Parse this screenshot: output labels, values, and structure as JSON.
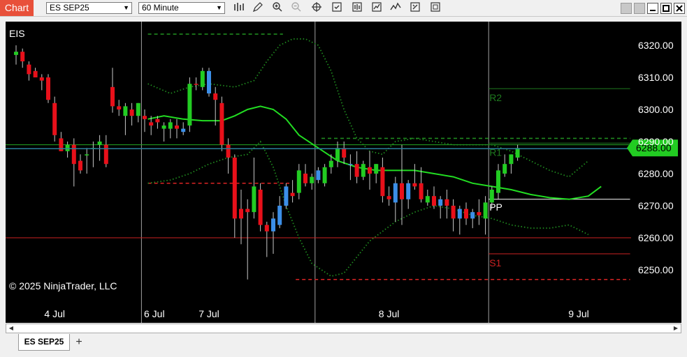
{
  "toolbar": {
    "chart_label": "Chart",
    "instrument": "ES SEP25",
    "interval": "60 Minute",
    "icons": [
      "bars-type-icon",
      "draw-pencil-icon",
      "zoom-in-icon",
      "zoom-out-icon",
      "crosshair-icon",
      "properties-icon",
      "data-box-icon",
      "indicators-icon",
      "strategies-icon",
      "templates-icon",
      "trade-icon"
    ],
    "window_buttons": [
      "restore-icon",
      "minimize-icon",
      "maximize-icon",
      "close-icon"
    ]
  },
  "tabs": {
    "active": "ES SEP25",
    "add": "+"
  },
  "chart_data": {
    "type": "candlestick",
    "symbol_label": "EIS",
    "copyright": "© 2025 NinjaTrader, LLC",
    "ylim": [
      6242,
      6330
    ],
    "y_ticks": [
      6320,
      6310,
      6300,
      6290,
      6280,
      6270,
      6260,
      6250
    ],
    "y_tick_labels": [
      "6320.00",
      "6310.00",
      "6300.00",
      "6290.00",
      "6280.00",
      "6270.00",
      "6260.00",
      "6250.00"
    ],
    "x_labels": [
      {
        "label": "4 Jul",
        "bar": 6
      },
      {
        "label": "6 Jul",
        "bar": 21.5
      },
      {
        "label": "7 Jul",
        "bar": 30
      },
      {
        "label": "8 Jul",
        "bar": 58
      },
      {
        "label": "9 Jul",
        "bar": 87.5
      }
    ],
    "session_breaks": [
      19.5,
      46.5,
      73.5
    ],
    "last_price": 6288.0,
    "last_price_label": "6288.00",
    "reference_lines": [
      {
        "price": 6289.0,
        "color": "#22aa22",
        "style": "solid"
      },
      {
        "price": 6260.0,
        "color": "#cc2222",
        "style": "solid"
      }
    ],
    "pivot_levels": [
      {
        "name": "R2",
        "label": "R2",
        "price": 6306.5,
        "x0": 73.5,
        "x1": 95.5,
        "color": "#1f7a1f",
        "style": "solid"
      },
      {
        "name": "R1",
        "label": "R1",
        "price": 6289.5,
        "x0": 73.5,
        "x1": 95.5,
        "color": "#1f7a1f",
        "style": "solid"
      },
      {
        "name": "PP",
        "label": "PP",
        "price": 6272.0,
        "x0": 73.5,
        "x1": 95.5,
        "color": "#ffffff",
        "style": "solid"
      },
      {
        "name": "S1",
        "label": "S1",
        "price": 6255.0,
        "x0": 73.5,
        "x1": 95.5,
        "color": "#cc2222",
        "style": "solid"
      },
      {
        "name": "prior-R",
        "price": 6323.5,
        "x0": 20.5,
        "x1": 41.5,
        "color": "#1f8a1f",
        "style": "dashed"
      },
      {
        "name": "prior-S",
        "price": 6277.0,
        "x0": 20.5,
        "x1": 42.5,
        "color": "#cc2222",
        "style": "dashed"
      },
      {
        "name": "day-R",
        "price": 6291.0,
        "x0": 47.5,
        "x1": 95.5,
        "color": "#1f8a1f",
        "style": "dashed"
      },
      {
        "name": "day-S",
        "price": 6247.0,
        "x0": 43.5,
        "x1": 95.5,
        "color": "#cc2222",
        "style": "dashed"
      }
    ],
    "colors": {
      "up": "#22cc22",
      "down": "#e8101a",
      "bull_neutral": "#3c8fe8",
      "ma": "#22dd22",
      "bands": "#1f8a1f",
      "wick": "#c8c8c8"
    },
    "series": [
      {
        "name": "OHLC",
        "bars": [
          {
            "o": 6317,
            "h": 6320,
            "l": 6314,
            "c": 6318,
            "col": "up"
          },
          {
            "o": 6318,
            "h": 6319,
            "l": 6313,
            "c": 6315,
            "col": "down"
          },
          {
            "o": 6314,
            "h": 6315,
            "l": 6309,
            "c": 6311,
            "col": "down"
          },
          {
            "o": 6312,
            "h": 6313,
            "l": 6310,
            "c": 6310,
            "col": "down"
          },
          {
            "o": 6309,
            "h": 6311,
            "l": 6306,
            "c": 6310,
            "col": "down"
          },
          {
            "o": 6310,
            "h": 6311,
            "l": 6302,
            "c": 6303,
            "col": "down"
          },
          {
            "o": 6302,
            "h": 6304,
            "l": 6290,
            "c": 6292,
            "col": "down"
          },
          {
            "o": 6291,
            "h": 6293,
            "l": 6287,
            "c": 6287,
            "col": "down"
          },
          {
            "o": 6287,
            "h": 6290,
            "l": 6285,
            "c": 6289,
            "col": "up"
          },
          {
            "o": 6289,
            "h": 6291,
            "l": 6276,
            "c": 6283,
            "col": "down"
          },
          {
            "o": 6284,
            "h": 6286,
            "l": 6280,
            "c": 6281,
            "col": "down"
          },
          {
            "o": 6286,
            "h": 6288,
            "l": 6280,
            "c": 6286,
            "col": "up"
          },
          {
            "o": 6288,
            "h": 6290,
            "l": 6282,
            "c": 6288,
            "col": "up"
          },
          {
            "o": 6290,
            "h": 6292,
            "l": 6284,
            "c": 6289,
            "col": "up"
          },
          {
            "o": 6289,
            "h": 6292,
            "l": 6282,
            "c": 6283,
            "col": "down"
          },
          {
            "o": 6307,
            "h": 6313,
            "l": 6299,
            "c": 6301,
            "col": "down"
          },
          {
            "o": 6301,
            "h": 6303,
            "l": 6298,
            "c": 6300,
            "col": "down"
          },
          {
            "o": 6298,
            "h": 6302,
            "l": 6292,
            "c": 6301,
            "col": "up"
          },
          {
            "o": 6300,
            "h": 6302,
            "l": 6295,
            "c": 6298,
            "col": "down"
          },
          {
            "o": 6298,
            "h": 6302,
            "l": 6296,
            "c": 6302,
            "col": "up"
          },
          {
            "o": 6298,
            "h": 6300,
            "l": 6293,
            "c": 6297,
            "col": "down"
          },
          {
            "o": 6296,
            "h": 6298,
            "l": 6292,
            "c": 6295,
            "col": "down"
          },
          {
            "o": 6297,
            "h": 6298,
            "l": 6294,
            "c": 6296,
            "col": "down"
          },
          {
            "o": 6294,
            "h": 6296,
            "l": 6290,
            "c": 6295,
            "col": "up"
          },
          {
            "o": 6294,
            "h": 6297,
            "l": 6291,
            "c": 6296,
            "col": "up"
          },
          {
            "o": 6295,
            "h": 6297,
            "l": 6291,
            "c": 6294,
            "col": "down"
          },
          {
            "o": 6293,
            "h": 6296,
            "l": 6292,
            "c": 6294,
            "col": "bull_neutral"
          },
          {
            "o": 6295,
            "h": 6310,
            "l": 6293,
            "c": 6308,
            "col": "up"
          },
          {
            "o": 6308,
            "h": 6310,
            "l": 6306,
            "c": 6308,
            "col": "down"
          },
          {
            "o": 6307,
            "h": 6313,
            "l": 6306,
            "c": 6312,
            "col": "up"
          },
          {
            "o": 6312,
            "h": 6313,
            "l": 6304,
            "c": 6305,
            "col": "bull_neutral"
          },
          {
            "o": 6305,
            "h": 6307,
            "l": 6295,
            "c": 6303,
            "col": "down"
          },
          {
            "o": 6302,
            "h": 6304,
            "l": 6287,
            "c": 6289,
            "col": "down"
          },
          {
            "o": 6289,
            "h": 6291,
            "l": 6280,
            "c": 6285,
            "col": "down"
          },
          {
            "o": 6285,
            "h": 6286,
            "l": 6260,
            "c": 6266,
            "col": "down"
          },
          {
            "o": 6266,
            "h": 6275,
            "l": 6258,
            "c": 6269,
            "col": "down"
          },
          {
            "o": 6269,
            "h": 6272,
            "l": 6247,
            "c": 6268,
            "col": "down"
          },
          {
            "o": 6268,
            "h": 6285,
            "l": 6266,
            "c": 6276,
            "col": "up"
          },
          {
            "o": 6275,
            "h": 6277,
            "l": 6262,
            "c": 6264,
            "col": "down"
          },
          {
            "o": 6264,
            "h": 6265,
            "l": 6254,
            "c": 6262,
            "col": "down"
          },
          {
            "o": 6262,
            "h": 6268,
            "l": 6255,
            "c": 6266,
            "col": "bull_neutral"
          },
          {
            "o": 6264,
            "h": 6273,
            "l": 6263,
            "c": 6270,
            "col": "bull_neutral"
          },
          {
            "o": 6270,
            "h": 6277,
            "l": 6269,
            "c": 6276,
            "col": "bull_neutral"
          },
          {
            "o": 6273,
            "h": 6278,
            "l": 6271,
            "c": 6274,
            "col": "down"
          },
          {
            "o": 6274,
            "h": 6283,
            "l": 6272,
            "c": 6281,
            "col": "up"
          },
          {
            "o": 6280,
            "h": 6283,
            "l": 6276,
            "c": 6277,
            "col": "down"
          },
          {
            "o": 6277,
            "h": 6280,
            "l": 6275,
            "c": 6279,
            "col": "up"
          },
          {
            "o": 6278,
            "h": 6282,
            "l": 6277,
            "c": 6281,
            "col": "bull_neutral"
          },
          {
            "o": 6277,
            "h": 6283,
            "l": 6276,
            "c": 6282,
            "col": "up"
          },
          {
            "o": 6282,
            "h": 6286,
            "l": 6280,
            "c": 6284,
            "col": "up"
          },
          {
            "o": 6284,
            "h": 6290,
            "l": 6282,
            "c": 6288,
            "col": "up"
          },
          {
            "o": 6288,
            "h": 6290,
            "l": 6283,
            "c": 6285,
            "col": "down"
          },
          {
            "o": 6283,
            "h": 6286,
            "l": 6278,
            "c": 6283,
            "col": "bull_neutral"
          },
          {
            "o": 6283,
            "h": 6287,
            "l": 6277,
            "c": 6279,
            "col": "down"
          },
          {
            "o": 6279,
            "h": 6284,
            "l": 6278,
            "c": 6283,
            "col": "up"
          },
          {
            "o": 6282,
            "h": 6287,
            "l": 6275,
            "c": 6280,
            "col": "down"
          },
          {
            "o": 6280,
            "h": 6283,
            "l": 6277,
            "c": 6283,
            "col": "up"
          },
          {
            "o": 6282,
            "h": 6285,
            "l": 6271,
            "c": 6273,
            "col": "down"
          },
          {
            "o": 6273,
            "h": 6276,
            "l": 6270,
            "c": 6272,
            "col": "down"
          },
          {
            "o": 6271,
            "h": 6279,
            "l": 6265,
            "c": 6277,
            "col": "bull_neutral"
          },
          {
            "o": 6277,
            "h": 6289,
            "l": 6264,
            "c": 6272,
            "col": "down"
          },
          {
            "o": 6272,
            "h": 6278,
            "l": 6269,
            "c": 6277,
            "col": "bull_neutral"
          },
          {
            "o": 6277,
            "h": 6283,
            "l": 6275,
            "c": 6276,
            "col": "down"
          },
          {
            "o": 6277,
            "h": 6282,
            "l": 6271,
            "c": 6272,
            "col": "down"
          },
          {
            "o": 6271,
            "h": 6275,
            "l": 6270,
            "c": 6273,
            "col": "up"
          },
          {
            "o": 6273,
            "h": 6276,
            "l": 6269,
            "c": 6270,
            "col": "down"
          },
          {
            "o": 6270,
            "h": 6273,
            "l": 6266,
            "c": 6272,
            "col": "bull_neutral"
          },
          {
            "o": 6272,
            "h": 6275,
            "l": 6266,
            "c": 6270,
            "col": "down"
          },
          {
            "o": 6270,
            "h": 6272,
            "l": 6262,
            "c": 6266,
            "col": "down"
          },
          {
            "o": 6266,
            "h": 6270,
            "l": 6261,
            "c": 6269,
            "col": "bull_neutral"
          },
          {
            "o": 6269,
            "h": 6271,
            "l": 6264,
            "c": 6266,
            "col": "down"
          },
          {
            "o": 6266,
            "h": 6269,
            "l": 6263,
            "c": 6268,
            "col": "bull_neutral"
          },
          {
            "o": 6268,
            "h": 6272,
            "l": 6264,
            "c": 6267,
            "col": "down"
          },
          {
            "o": 6266,
            "h": 6273,
            "l": 6261,
            "c": 6271,
            "col": "up"
          },
          {
            "o": 6271,
            "h": 6276,
            "l": 6269,
            "c": 6275,
            "col": "up"
          },
          {
            "o": 6274,
            "h": 6283,
            "l": 6272,
            "c": 6281,
            "col": "up"
          },
          {
            "o": 6280,
            "h": 6286,
            "l": 6279,
            "c": 6283,
            "col": "up"
          },
          {
            "o": 6283,
            "h": 6286,
            "l": 6280,
            "c": 6286,
            "col": "up"
          },
          {
            "o": 6285,
            "h": 6289,
            "l": 6284,
            "c": 6288,
            "col": "up"
          }
        ]
      },
      {
        "name": "MA",
        "points": [
          [
            20.5,
            6297
          ],
          [
            23,
            6298
          ],
          [
            26,
            6297
          ],
          [
            29,
            6296.5
          ],
          [
            32,
            6296.5
          ],
          [
            34,
            6298
          ],
          [
            36,
            6300
          ],
          [
            38,
            6301
          ],
          [
            40,
            6300
          ],
          [
            42,
            6297
          ],
          [
            44,
            6292
          ],
          [
            47,
            6288
          ],
          [
            50,
            6284
          ],
          [
            53,
            6282
          ],
          [
            56,
            6281
          ],
          [
            59,
            6281
          ],
          [
            62,
            6281
          ],
          [
            65,
            6280
          ],
          [
            68,
            6279
          ],
          [
            71,
            6277
          ],
          [
            74,
            6276
          ],
          [
            77,
            6275
          ],
          [
            80,
            6273.5
          ],
          [
            83,
            6272.5
          ],
          [
            86,
            6272
          ],
          [
            89,
            6273
          ],
          [
            91,
            6276
          ]
        ]
      },
      {
        "name": "BandUpper",
        "points": [
          [
            20.5,
            6308
          ],
          [
            24,
            6305
          ],
          [
            27,
            6307
          ],
          [
            30,
            6308
          ],
          [
            34,
            6307
          ],
          [
            37,
            6309
          ],
          [
            39,
            6315
          ],
          [
            41,
            6320
          ],
          [
            43,
            6322
          ],
          [
            45,
            6322
          ],
          [
            47,
            6320
          ],
          [
            49,
            6312
          ],
          [
            51,
            6300
          ],
          [
            53,
            6291
          ],
          [
            55,
            6287
          ],
          [
            57,
            6286
          ],
          [
            59,
            6290
          ],
          [
            62,
            6291
          ],
          [
            65,
            6290
          ],
          [
            68,
            6289
          ],
          [
            71,
            6289
          ],
          [
            74,
            6289
          ],
          [
            77,
            6287
          ],
          [
            80,
            6284
          ],
          [
            83,
            6281
          ],
          [
            86,
            6279
          ],
          [
            89,
            6284
          ]
        ]
      },
      {
        "name": "BandLower",
        "points": [
          [
            20.5,
            6277
          ],
          [
            24,
            6278
          ],
          [
            27,
            6280
          ],
          [
            30,
            6283
          ],
          [
            33,
            6285
          ],
          [
            36,
            6286
          ],
          [
            38,
            6290
          ],
          [
            40,
            6282
          ],
          [
            42,
            6270
          ],
          [
            44,
            6260
          ],
          [
            46,
            6252
          ],
          [
            49,
            6248
          ],
          [
            51,
            6249
          ],
          [
            53,
            6254
          ],
          [
            55,
            6259
          ],
          [
            57,
            6262
          ],
          [
            59,
            6265
          ],
          [
            62,
            6268
          ],
          [
            65,
            6270
          ],
          [
            68,
            6269
          ],
          [
            71,
            6267
          ],
          [
            74,
            6266
          ],
          [
            77,
            6264
          ],
          [
            80,
            6263
          ],
          [
            83,
            6263
          ],
          [
            86,
            6264
          ],
          [
            89,
            6261
          ]
        ]
      }
    ]
  }
}
